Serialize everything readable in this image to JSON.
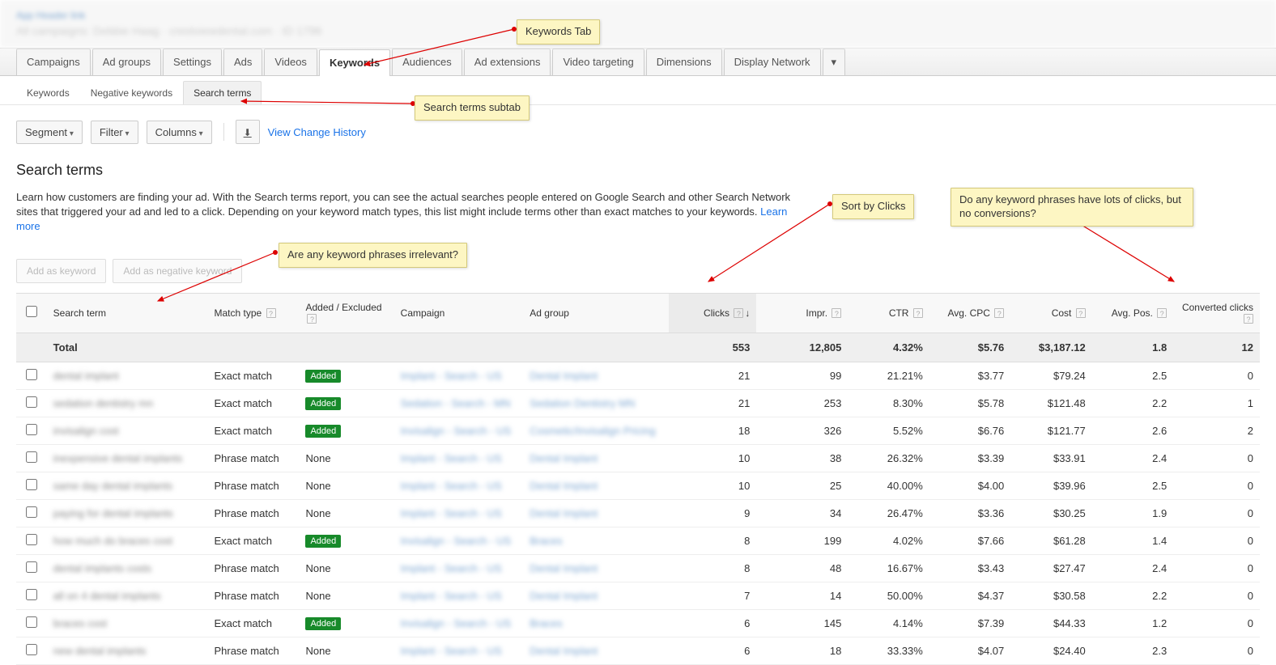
{
  "header_blur": {
    "line1": "App Header link",
    "line2": "All campaigns: Debbie Haag · crestviewdental.com · ID 1796"
  },
  "tabs": [
    "Campaigns",
    "Ad groups",
    "Settings",
    "Ads",
    "Videos",
    "Keywords",
    "Audiences",
    "Ad extensions",
    "Video targeting",
    "Dimensions",
    "Display Network"
  ],
  "tabs_active_index": 5,
  "subtabs": [
    "Keywords",
    "Negative keywords",
    "Search terms"
  ],
  "subtabs_active_index": 2,
  "toolbar": {
    "segment": "Segment",
    "filter": "Filter",
    "columns": "Columns",
    "history_link": "View Change History"
  },
  "section": {
    "title": "Search terms",
    "desc": "Learn how customers are finding your ad. With the Search terms report, you can see the actual searches people entered on Google Search and other Search Network sites that triggered your ad and led to a click. Depending on your keyword match types, this list might include terms other than exact matches to your keywords. ",
    "learn_more": "Learn more"
  },
  "actions": {
    "add_keyword": "Add as keyword",
    "add_negative": "Add as negative keyword"
  },
  "columns": {
    "term": "Search term",
    "match": "Match type",
    "added": "Added / Excluded",
    "campaign": "Campaign",
    "adgroup": "Ad group",
    "clicks": "Clicks",
    "impr": "Impr.",
    "ctr": "CTR",
    "cpc": "Avg. CPC",
    "cost": "Cost",
    "pos": "Avg. Pos.",
    "conv": "Converted clicks"
  },
  "total": {
    "label": "Total",
    "clicks": "553",
    "impr": "12,805",
    "ctr": "4.32%",
    "cpc": "$5.76",
    "cost": "$3,187.12",
    "pos": "1.8",
    "conv": "12"
  },
  "rows": [
    {
      "term": "dental implant",
      "match": "Exact match",
      "added": "Added",
      "campaign": "Implant - Search - US",
      "adgroup": "Dental Implant",
      "clicks": "21",
      "impr": "99",
      "ctr": "21.21%",
      "cpc": "$3.77",
      "cost": "$79.24",
      "pos": "2.5",
      "conv": "0"
    },
    {
      "term": "sedation dentistry mn",
      "match": "Exact match",
      "added": "Added",
      "campaign": "Sedation - Search - MN",
      "adgroup": "Sedation Dentistry MN",
      "clicks": "21",
      "impr": "253",
      "ctr": "8.30%",
      "cpc": "$5.78",
      "cost": "$121.48",
      "pos": "2.2",
      "conv": "1"
    },
    {
      "term": "invisalign cost",
      "match": "Exact match",
      "added": "Added",
      "campaign": "Invisalign - Search - US",
      "adgroup": "Cosmetic/Invisalign Pricing",
      "clicks": "18",
      "impr": "326",
      "ctr": "5.52%",
      "cpc": "$6.76",
      "cost": "$121.77",
      "pos": "2.6",
      "conv": "2"
    },
    {
      "term": "inexpensive dental implants",
      "match": "Phrase match",
      "added": "None",
      "campaign": "Implant - Search - US",
      "adgroup": "Dental Implant",
      "clicks": "10",
      "impr": "38",
      "ctr": "26.32%",
      "cpc": "$3.39",
      "cost": "$33.91",
      "pos": "2.4",
      "conv": "0"
    },
    {
      "term": "same day dental implants",
      "match": "Phrase match",
      "added": "None",
      "campaign": "Implant - Search - US",
      "adgroup": "Dental Implant",
      "clicks": "10",
      "impr": "25",
      "ctr": "40.00%",
      "cpc": "$4.00",
      "cost": "$39.96",
      "pos": "2.5",
      "conv": "0"
    },
    {
      "term": "paying for dental implants",
      "match": "Phrase match",
      "added": "None",
      "campaign": "Implant - Search - US",
      "adgroup": "Dental Implant",
      "clicks": "9",
      "impr": "34",
      "ctr": "26.47%",
      "cpc": "$3.36",
      "cost": "$30.25",
      "pos": "1.9",
      "conv": "0"
    },
    {
      "term": "how much do braces cost",
      "match": "Exact match",
      "added": "Added",
      "campaign": "Invisalign - Search - US",
      "adgroup": "Braces",
      "clicks": "8",
      "impr": "199",
      "ctr": "4.02%",
      "cpc": "$7.66",
      "cost": "$61.28",
      "pos": "1.4",
      "conv": "0"
    },
    {
      "term": "dental implants costs",
      "match": "Phrase match",
      "added": "None",
      "campaign": "Implant - Search - US",
      "adgroup": "Dental Implant",
      "clicks": "8",
      "impr": "48",
      "ctr": "16.67%",
      "cpc": "$3.43",
      "cost": "$27.47",
      "pos": "2.4",
      "conv": "0"
    },
    {
      "term": "all on 4 dental implants",
      "match": "Phrase match",
      "added": "None",
      "campaign": "Implant - Search - US",
      "adgroup": "Dental Implant",
      "clicks": "7",
      "impr": "14",
      "ctr": "50.00%",
      "cpc": "$4.37",
      "cost": "$30.58",
      "pos": "2.2",
      "conv": "0"
    },
    {
      "term": "braces cost",
      "match": "Exact match",
      "added": "Added",
      "campaign": "Invisalign - Search - US",
      "adgroup": "Braces",
      "clicks": "6",
      "impr": "145",
      "ctr": "4.14%",
      "cpc": "$7.39",
      "cost": "$44.33",
      "pos": "1.2",
      "conv": "0"
    },
    {
      "term": "new dental implants",
      "match": "Phrase match",
      "added": "None",
      "campaign": "Implant - Search - US",
      "adgroup": "Dental Implant",
      "clicks": "6",
      "impr": "18",
      "ctr": "33.33%",
      "cpc": "$4.07",
      "cost": "$24.40",
      "pos": "2.3",
      "conv": "0"
    }
  ],
  "annotations": {
    "keywords_tab": "Keywords Tab",
    "search_terms_subtab": "Search terms subtab",
    "sort_by_clicks": "Sort by Clicks",
    "conversions_question": "Do any keyword phrases have lots of clicks, but no conversions?",
    "irrelevant_question": "Are any keyword phrases irrelevant?"
  }
}
